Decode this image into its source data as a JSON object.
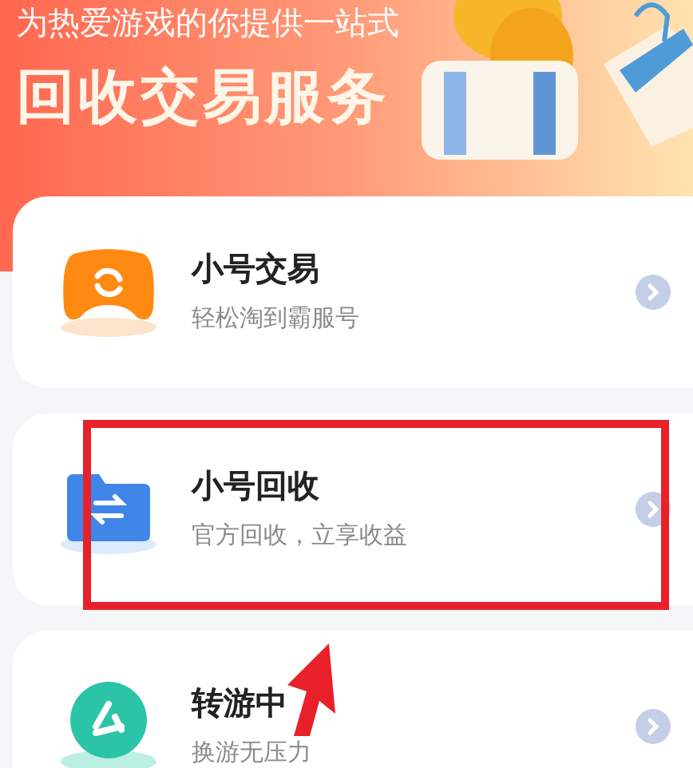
{
  "banner": {
    "subtitle": "为热爱游戏的你提供一站式",
    "title": "回收交易服务"
  },
  "services": [
    {
      "kind": "trade",
      "title": "小号交易",
      "subtitle": "轻松淘到霸服号",
      "highlighted": false
    },
    {
      "kind": "recycle",
      "title": "小号回收",
      "subtitle": "官方回收，立享收益",
      "highlighted": true
    },
    {
      "kind": "transfer",
      "title": "转游中",
      "subtitle": "换游无压力",
      "highlighted": false
    }
  ]
}
